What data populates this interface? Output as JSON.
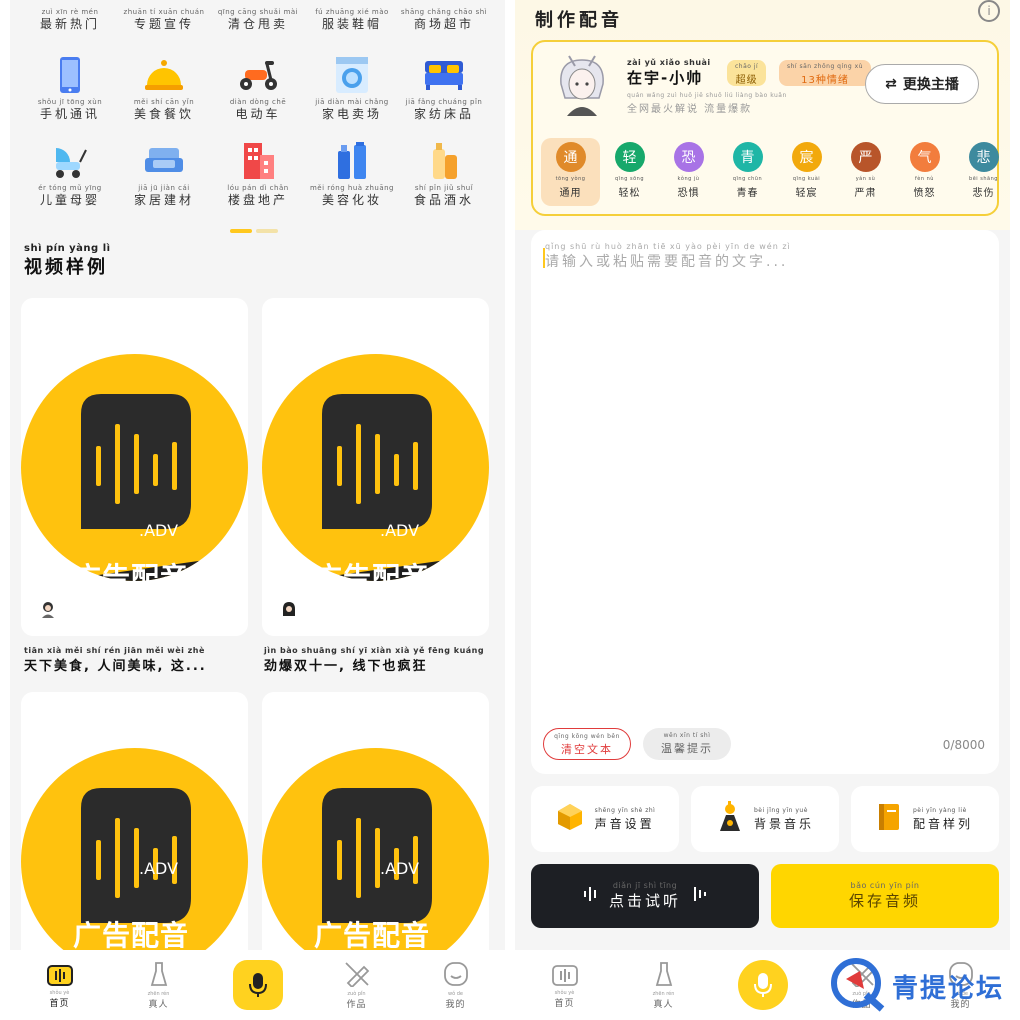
{
  "left": {
    "categories": [
      {
        "py": "zuì xīn rè mén",
        "label": "最新热门",
        "icon": "fire-icon"
      },
      {
        "py": "zhuān tí xuān chuán",
        "label": "专题宣传",
        "icon": "megaphone-icon"
      },
      {
        "py": "qīng cāng shuǎi mài",
        "label": "清仓甩卖",
        "icon": "sale-tag-icon"
      },
      {
        "py": "fú zhuāng xié mào",
        "label": "服装鞋帽",
        "icon": "clothes-icon"
      },
      {
        "py": "shāng chǎng chāo shì",
        "label": "商场超市",
        "icon": "store-icon"
      },
      {
        "py": "shǒu jī tōng xùn",
        "label": "手机通讯",
        "icon": "phone-icon"
      },
      {
        "py": "měi shí cān yǐn",
        "label": "美食餐饮",
        "icon": "food-cloche-icon"
      },
      {
        "py": "diàn dòng chē",
        "label": "电动车",
        "icon": "scooter-icon"
      },
      {
        "py": "jiā diàn mài chǎng",
        "label": "家电卖场",
        "icon": "washing-machine-icon"
      },
      {
        "py": "jiā fǎng chuáng pǐn",
        "label": "家纺床品",
        "icon": "bed-icon"
      },
      {
        "py": "ér tóng mǔ yīng",
        "label": "儿童母婴",
        "icon": "stroller-icon"
      },
      {
        "py": "jiā jū jiàn cái",
        "label": "家居建材",
        "icon": "sofa-icon"
      },
      {
        "py": "lóu pán dì chǎn",
        "label": "楼盘地产",
        "icon": "building-icon"
      },
      {
        "py": "měi róng huà zhuāng",
        "label": "美容化妆",
        "icon": "cosmetics-icon"
      },
      {
        "py": "shí pǐn jiǔ shuǐ",
        "label": "食品酒水",
        "icon": "bottle-icon"
      }
    ],
    "section": {
      "py": "shì pín yàng lì",
      "title": "视频样例"
    },
    "video_cards": [
      {
        "cover_text": "广告配音",
        "brand": ".ADV",
        "py": "tiān xià měi shí rén jiān měi wèi zhè",
        "caption": "天下美食, 人间美味, 这..."
      },
      {
        "cover_text": "广告配音",
        "brand": ".ADV",
        "py": "jìn bào shuāng shí yī xiàn xià yě fēng kuáng",
        "caption": "劲爆双十一, 线下也疯狂"
      },
      {
        "cover_text": "广告配音",
        "brand": ".ADV"
      },
      {
        "cover_text": "广告配音",
        "brand": ".ADV"
      }
    ],
    "tabs": [
      {
        "py": "shǒu yè",
        "label": "首页"
      },
      {
        "py": "zhēn rén",
        "label": "真人"
      },
      {
        "py": "",
        "label": ""
      },
      {
        "py": "zuò pǐn",
        "label": "作品"
      },
      {
        "py": "wǒ de",
        "label": "我的"
      }
    ]
  },
  "right": {
    "title": "制作配音",
    "anchor": {
      "name_py": "zài yǔ xiǎo shuài",
      "name": "在宇-小帅",
      "badge1_py": "chāo jí",
      "badge1": "超级",
      "badge2_py": "shí sān zhǒng qíng xù",
      "badge2": "13种情绪",
      "sub_py": "quán wǎng zuì huǒ jiě shuō liú liàng bào kuǎn",
      "sub": "全网最火解说 流量爆款",
      "switch_label": "更换主播"
    },
    "styles": [
      {
        "char": "通",
        "py": "tōng yòng",
        "label": "通用",
        "color": "#e08a2a"
      },
      {
        "char": "轻",
        "py": "qīng sōng",
        "label": "轻松",
        "color": "#17a86b"
      },
      {
        "char": "恐",
        "py": "kǒng jù",
        "label": "恐惧",
        "color": "#a873e6"
      },
      {
        "char": "青",
        "py": "qīng chūn",
        "label": "青春",
        "color": "#1fb6a6"
      },
      {
        "char": "宸",
        "py": "qīng kuài",
        "label": "轻宸",
        "color": "#f2a90c"
      },
      {
        "char": "严",
        "py": "yán sù",
        "label": "严肃",
        "color": "#b8552a"
      },
      {
        "char": "气",
        "py": "fèn nù",
        "label": "愤怒",
        "color": "#f27d3d"
      },
      {
        "char": "悲",
        "py": "bēi shāng",
        "label": "悲伤",
        "color": "#3d8a9e"
      }
    ],
    "input": {
      "placeholder_py": "qǐng shū rù huò zhān tiē xū yào pèi yīn de wén zì",
      "placeholder": "请输入或粘贴需要配音的文字...",
      "clear_py": "qīng kōng wén běn",
      "clear": "清空文本",
      "tip_py": "wēn xīn tí shì",
      "tip": "温馨提示",
      "counter": "0/8000"
    },
    "tools": [
      {
        "py": "shēng yīn shè zhì",
        "label": "声音设置",
        "icon": "cube-icon"
      },
      {
        "py": "bèi jǐng yīn yuè",
        "label": "背景音乐",
        "icon": "music-note-icon"
      },
      {
        "py": "pèi yīn yàng liè",
        "label": "配音样列",
        "icon": "book-icon"
      }
    ],
    "listen": {
      "py": "diǎn jī shì tīng",
      "label": "点击试听"
    },
    "save": {
      "py": "bǎo cún yīn pín",
      "label": "保存音频"
    },
    "tabs": [
      {
        "py": "shǒu yè",
        "label": "首页"
      },
      {
        "py": "zhēn rén",
        "label": "真人"
      },
      {
        "py": "",
        "label": ""
      },
      {
        "py": "zuò pǐn",
        "label": "作品"
      },
      {
        "py": "wǒ de",
        "label": "我的"
      }
    ],
    "watermark": "青提论坛"
  }
}
